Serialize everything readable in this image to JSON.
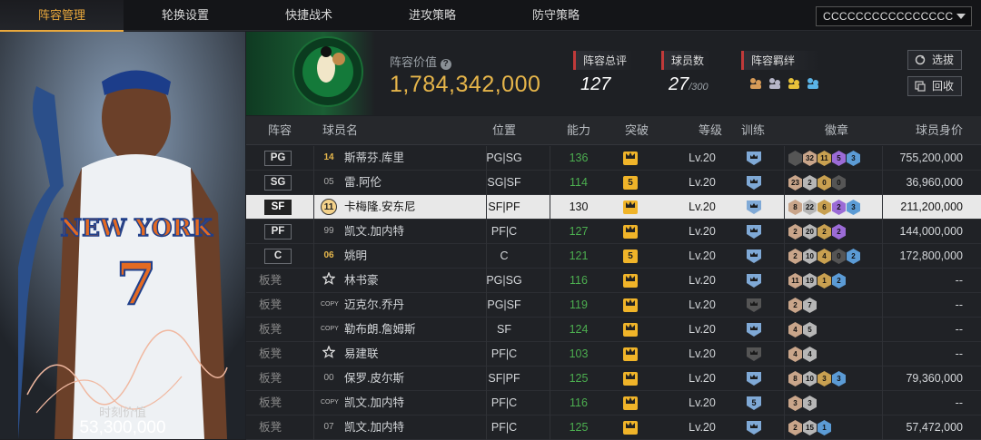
{
  "tabs": [
    {
      "label": "阵容管理",
      "active": true
    },
    {
      "label": "轮换设置"
    },
    {
      "label": "快捷战术"
    },
    {
      "label": "进攻策略"
    },
    {
      "label": "防守策略"
    }
  ],
  "account": {
    "name": "CCCCCCCCCCCCCCCC"
  },
  "left_card": {
    "moment_label": "时刻价值",
    "moment_value": "53,300,000"
  },
  "header": {
    "lineup_value_label": "阵容价值",
    "lineup_value": "1,784,342,000",
    "rating_label": "阵容总评",
    "rating": "127",
    "player_count_label": "球员数",
    "player_count": "27",
    "player_count_max": "/300",
    "bond_label": "阵容羁绊",
    "select_label": "选拔",
    "recycle_label": "回收"
  },
  "columns": [
    "阵容",
    "球员名",
    "位置",
    "能力",
    "突破",
    "等级",
    "训练",
    "徽章",
    "球员身价"
  ],
  "colors": {
    "accent": "#e9a83c",
    "green": "#4caf50",
    "gold": "#f0b429"
  },
  "rows": [
    {
      "slot": "PG",
      "num": "14",
      "num_style": "gold",
      "name": "斯蒂芬.库里",
      "pos": "PG|SG",
      "ability": "136",
      "brk": "crown",
      "level": "Lv.20",
      "train": "crown",
      "badges": [
        [
          "",
          "#555"
        ],
        [
          "32",
          "#c9a58a"
        ],
        [
          "11",
          "#c8a050"
        ],
        [
          "5",
          "#9b6bd6"
        ],
        [
          "3",
          "#5b9bd5"
        ]
      ],
      "value": "755,200,000"
    },
    {
      "slot": "SG",
      "num": "05",
      "num_style": "plain",
      "name": "雷.阿伦",
      "pos": "SG|SF",
      "ability": "114",
      "brk": "5",
      "level": "Lv.20",
      "train": "crown",
      "badges": [
        [
          "23",
          "#c9a58a"
        ],
        [
          "2",
          "#b6b6b6"
        ],
        [
          "0",
          "#c8a050"
        ],
        [
          "0",
          "#555"
        ]
      ],
      "value": "36,960,000"
    },
    {
      "slot": "SF",
      "num": "11",
      "num_style": "circ",
      "name": "卡梅隆.安东尼",
      "pos": "SF|PF",
      "ability": "130",
      "brk": "crown",
      "level": "Lv.20",
      "train": "crown",
      "badges": [
        [
          "8",
          "#c9a58a"
        ],
        [
          "22",
          "#b6b6b6"
        ],
        [
          "6",
          "#c8a050"
        ],
        [
          "2",
          "#9b6bd6"
        ],
        [
          "3",
          "#5b9bd5"
        ]
      ],
      "value": "211,200,000",
      "selected": true
    },
    {
      "slot": "PF",
      "num": "99",
      "num_style": "plain",
      "name": "凯文.加内特",
      "pos": "PF|C",
      "ability": "127",
      "brk": "crown",
      "level": "Lv.20",
      "train": "crown",
      "badges": [
        [
          "2",
          "#c9a58a"
        ],
        [
          "20",
          "#b6b6b6"
        ],
        [
          "2",
          "#c8a050"
        ],
        [
          "2",
          "#9b6bd6"
        ]
      ],
      "value": "144,000,000"
    },
    {
      "slot": "C",
      "num": "06",
      "num_style": "gold",
      "name": "姚明",
      "pos": "C",
      "ability": "121",
      "brk": "5",
      "level": "Lv.20",
      "train": "crown",
      "badges": [
        [
          "2",
          "#c9a58a"
        ],
        [
          "10",
          "#b6b6b6"
        ],
        [
          "4",
          "#c8a050"
        ],
        [
          "0",
          "#555"
        ],
        [
          "2",
          "#5b9bd5"
        ]
      ],
      "value": "172,800,000"
    },
    {
      "slot": "板凳",
      "num": "★",
      "num_style": "star",
      "name": "林书豪",
      "pos": "PG|SG",
      "ability": "116",
      "brk": "crown",
      "level": "Lv.20",
      "train": "crown",
      "badges": [
        [
          "11",
          "#c9a58a"
        ],
        [
          "19",
          "#b6b6b6"
        ],
        [
          "1",
          "#c8a050"
        ],
        [
          "2",
          "#5b9bd5"
        ]
      ],
      "value": "--"
    },
    {
      "slot": "板凳",
      "num": "COPY",
      "num_style": "copy",
      "name": "迈克尔.乔丹",
      "pos": "PG|SF",
      "ability": "119",
      "brk": "crown",
      "level": "Lv.20",
      "train": "gray",
      "badges": [
        [
          "2",
          "#c9a58a"
        ],
        [
          "7",
          "#b6b6b6"
        ]
      ],
      "value": "--"
    },
    {
      "slot": "板凳",
      "num": "COPY",
      "num_style": "copy",
      "name": "勒布朗.詹姆斯",
      "pos": "SF",
      "ability": "124",
      "brk": "crown",
      "level": "Lv.20",
      "train": "crown",
      "badges": [
        [
          "4",
          "#c9a58a"
        ],
        [
          "5",
          "#b6b6b6"
        ]
      ],
      "value": "--"
    },
    {
      "slot": "板凳",
      "num": "★",
      "num_style": "star",
      "name": "易建联",
      "pos": "PF|C",
      "ability": "103",
      "brk": "crown",
      "level": "Lv.20",
      "train": "gray",
      "badges": [
        [
          "4",
          "#c9a58a"
        ],
        [
          "4",
          "#b6b6b6"
        ]
      ],
      "value": "--"
    },
    {
      "slot": "板凳",
      "num": "00",
      "num_style": "plain",
      "name": "保罗.皮尔斯",
      "pos": "SF|PF",
      "ability": "125",
      "brk": "crown",
      "level": "Lv.20",
      "train": "crown",
      "badges": [
        [
          "8",
          "#c9a58a"
        ],
        [
          "10",
          "#b6b6b6"
        ],
        [
          "3",
          "#c8a050"
        ],
        [
          "3",
          "#5b9bd5"
        ]
      ],
      "value": "79,360,000"
    },
    {
      "slot": "板凳",
      "num": "COPY",
      "num_style": "copy",
      "name": "凯文.加内特",
      "pos": "PF|C",
      "ability": "116",
      "brk": "crown",
      "level": "Lv.20",
      "train": "5",
      "badges": [
        [
          "3",
          "#c9a58a"
        ],
        [
          "3",
          "#b6b6b6"
        ]
      ],
      "value": "--"
    },
    {
      "slot": "板凳",
      "num": "07",
      "num_style": "plain",
      "name": "凯文.加内特",
      "pos": "PF|C",
      "ability": "125",
      "brk": "crown",
      "level": "Lv.20",
      "train": "crown",
      "badges": [
        [
          "2",
          "#c9a58a"
        ],
        [
          "15",
          "#b6b6b6"
        ],
        [
          "1",
          "#5b9bd5"
        ]
      ],
      "value": "57,472,000"
    }
  ]
}
